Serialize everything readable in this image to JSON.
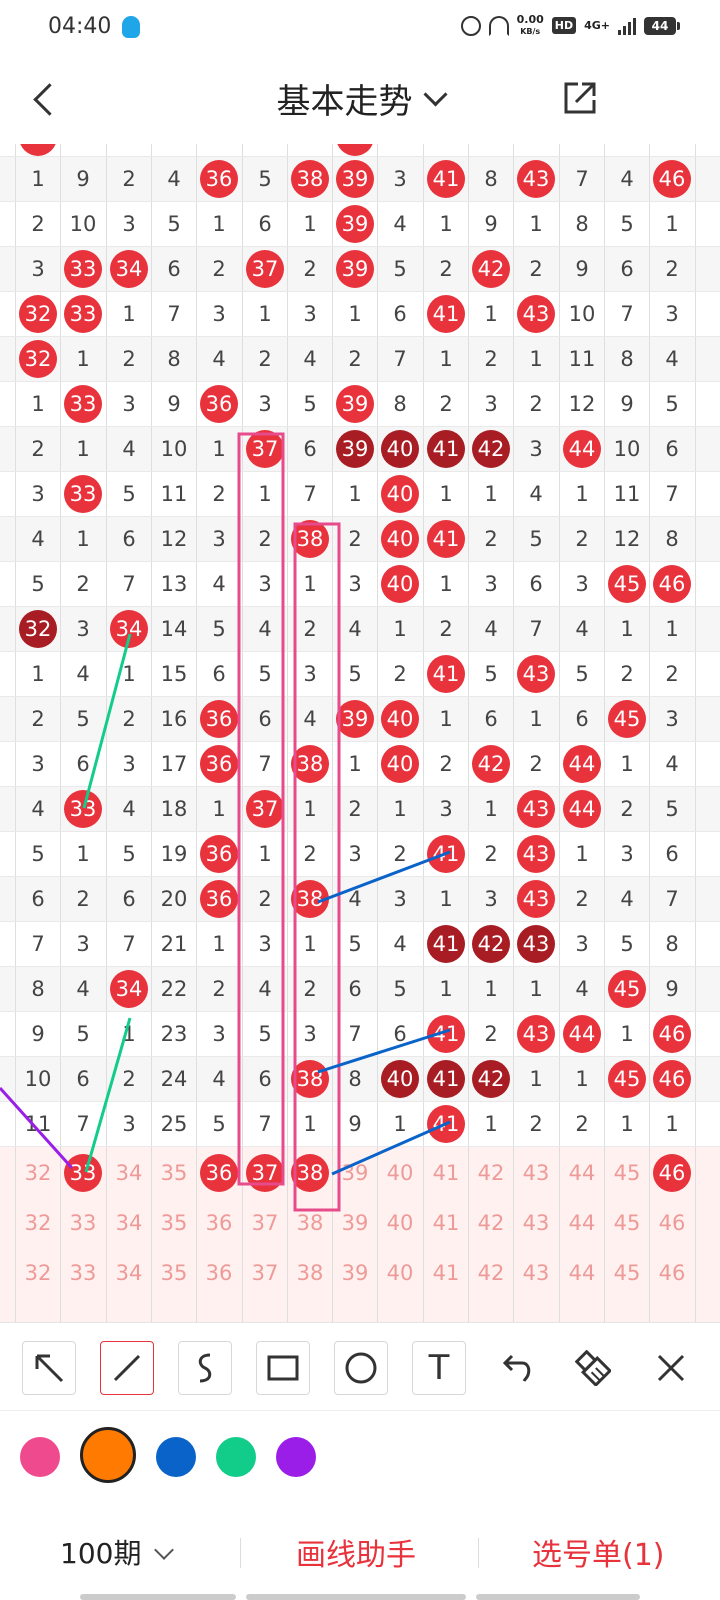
{
  "status_bar": {
    "time": "04:40",
    "net_speed_value": "0.00",
    "net_speed_unit": "KB/s",
    "hd": "HD",
    "network": "4G+",
    "battery": "44"
  },
  "header": {
    "title": "基本走势"
  },
  "grid": {
    "columns": [
      32,
      33,
      34,
      35,
      36,
      37,
      38,
      39,
      40,
      41,
      42,
      43,
      44,
      45,
      46
    ],
    "rows": [
      [
        1,
        9,
        2,
        4,
        "36",
        5,
        "38",
        "39",
        3,
        "41",
        8,
        "43",
        7,
        4,
        "46"
      ],
      [
        2,
        10,
        3,
        5,
        1,
        6,
        1,
        "39",
        4,
        1,
        9,
        1,
        8,
        5,
        1
      ],
      [
        3,
        "33",
        "34",
        6,
        2,
        "37",
        2,
        "39",
        5,
        2,
        "42",
        2,
        9,
        6,
        2
      ],
      [
        "32",
        "33",
        1,
        7,
        3,
        1,
        3,
        1,
        6,
        "41",
        1,
        "43",
        10,
        7,
        3
      ],
      [
        "32",
        1,
        2,
        8,
        4,
        2,
        4,
        2,
        7,
        1,
        2,
        1,
        11,
        8,
        4
      ],
      [
        1,
        "33",
        3,
        9,
        "36",
        3,
        5,
        "39",
        8,
        2,
        3,
        2,
        12,
        9,
        5
      ],
      [
        2,
        1,
        4,
        10,
        1,
        "37",
        6,
        "d39",
        "d40",
        "d41",
        "d42",
        3,
        "44",
        10,
        6
      ],
      [
        3,
        "33",
        5,
        11,
        2,
        1,
        7,
        1,
        "40",
        1,
        1,
        4,
        1,
        11,
        7
      ],
      [
        4,
        1,
        6,
        12,
        3,
        2,
        "38",
        2,
        "40",
        "41",
        2,
        5,
        2,
        12,
        8
      ],
      [
        5,
        2,
        7,
        13,
        4,
        3,
        1,
        3,
        "40",
        1,
        3,
        6,
        3,
        "45",
        "46"
      ],
      [
        "d32",
        3,
        "34",
        14,
        5,
        4,
        2,
        4,
        1,
        2,
        4,
        7,
        4,
        1,
        1
      ],
      [
        1,
        4,
        1,
        15,
        6,
        5,
        3,
        5,
        2,
        "41",
        5,
        "43",
        5,
        2,
        2
      ],
      [
        2,
        5,
        2,
        16,
        "36",
        6,
        4,
        "39",
        "40",
        1,
        6,
        1,
        6,
        "45",
        3
      ],
      [
        3,
        6,
        3,
        17,
        "36",
        7,
        "38",
        1,
        "40",
        2,
        "42",
        2,
        "44",
        1,
        4
      ],
      [
        4,
        "33",
        4,
        18,
        1,
        "37",
        1,
        2,
        1,
        3,
        1,
        "43",
        "44",
        2,
        5
      ],
      [
        5,
        1,
        5,
        19,
        "36",
        1,
        2,
        3,
        2,
        "41",
        2,
        "43",
        1,
        3,
        6
      ],
      [
        6,
        2,
        6,
        20,
        "36",
        2,
        "38",
        4,
        3,
        1,
        3,
        "43",
        2,
        4,
        7
      ],
      [
        7,
        3,
        7,
        21,
        1,
        3,
        1,
        5,
        4,
        "d41",
        "d42",
        "d43",
        3,
        5,
        8
      ],
      [
        8,
        4,
        "34",
        22,
        2,
        4,
        2,
        6,
        5,
        1,
        1,
        1,
        4,
        "45",
        9
      ],
      [
        9,
        5,
        1,
        23,
        3,
        5,
        3,
        7,
        6,
        "41",
        2,
        "43",
        "44",
        1,
        "46"
      ],
      [
        10,
        6,
        2,
        24,
        4,
        6,
        "38",
        8,
        "d40",
        "d41",
        "d42",
        1,
        1,
        "45",
        "46"
      ],
      [
        11,
        7,
        3,
        25,
        5,
        7,
        1,
        9,
        1,
        "41",
        1,
        2,
        2,
        1,
        1
      ]
    ],
    "pick_rows": [
      [
        "32",
        "33",
        "34",
        "35",
        "36",
        "37",
        "38",
        "39",
        "40",
        "41",
        "42",
        "43",
        "44",
        "45",
        "46"
      ],
      [
        "32",
        "33",
        "34",
        "35",
        "36",
        "37",
        "38",
        "39",
        "40",
        "41",
        "42",
        "43",
        "44",
        "45",
        "46"
      ],
      [
        "32",
        "33",
        "34",
        "35",
        "36",
        "37",
        "38",
        "39",
        "40",
        "41",
        "42",
        "43",
        "44",
        "45",
        "46"
      ]
    ],
    "pick_selected": [
      "33",
      "36",
      "37",
      "38",
      "46"
    ]
  },
  "toolbar": {
    "tools": [
      {
        "name": "arrow-tool",
        "icon": "arrow-up-left-icon"
      },
      {
        "name": "line-tool",
        "icon": "line-icon",
        "active": true
      },
      {
        "name": "curve-tool",
        "icon": "curve-icon"
      },
      {
        "name": "rect-tool",
        "icon": "rectangle-icon"
      },
      {
        "name": "circle-tool",
        "icon": "circle-icon"
      },
      {
        "name": "text-tool",
        "icon": "text-icon",
        "glyph": "T"
      },
      {
        "name": "undo-button",
        "icon": "undo-icon"
      },
      {
        "name": "eraser-button",
        "icon": "eraser-icon"
      },
      {
        "name": "close-button",
        "icon": "close-icon"
      }
    ]
  },
  "colors": [
    "#f04a8e",
    "#ff7a00",
    "#0a63c9",
    "#12cc8a",
    "#9a1ee8"
  ],
  "selected_color": "#ff7a00",
  "bottom_bar": {
    "periods": "100期",
    "draw_helper": "画线助手",
    "pick_list": "选号单(1)"
  }
}
